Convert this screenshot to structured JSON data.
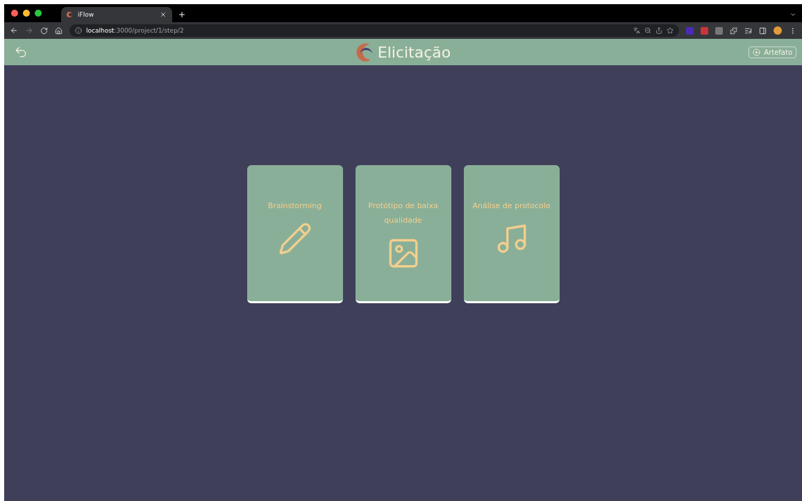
{
  "browser": {
    "tab": {
      "title": "iFlow",
      "selected": true
    },
    "address": {
      "host": "localhost",
      "path": ":3000/project/1/step/2"
    }
  },
  "header": {
    "title": "Elicitação",
    "action": "Artefato"
  },
  "cards": [
    {
      "title": "Brainstorming",
      "kind": "pencil"
    },
    {
      "title": "Protótipo de baixa qualidade",
      "kind": "image"
    },
    {
      "title": "Análise de protocolo",
      "kind": "music"
    }
  ]
}
